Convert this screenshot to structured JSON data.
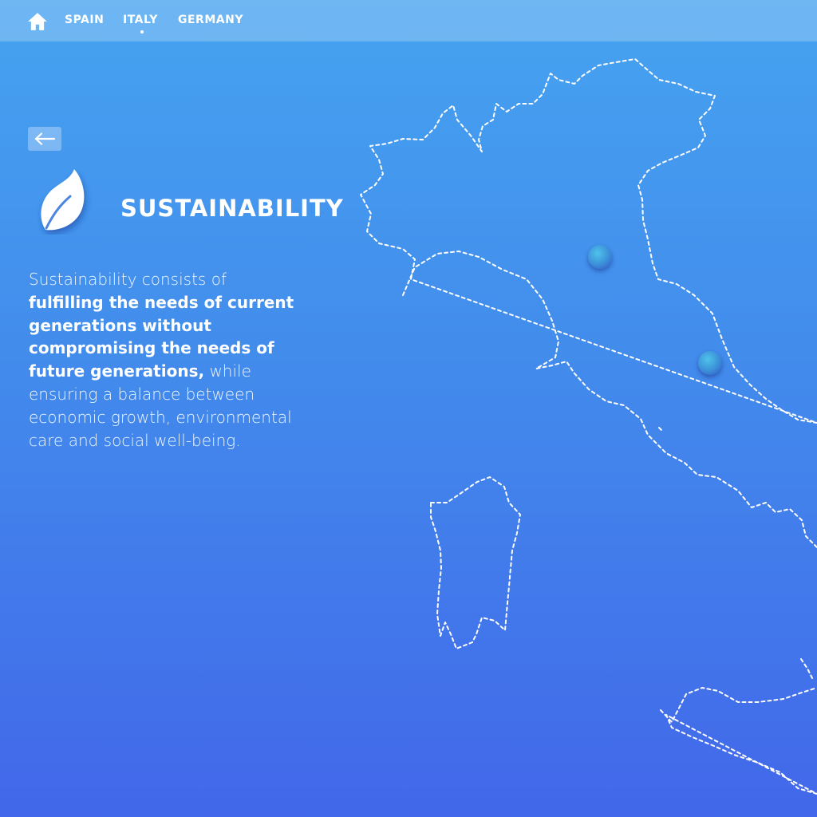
{
  "nav": {
    "home_icon": "home-icon",
    "links": [
      "SPAIN",
      "ITALY",
      "GERMANY"
    ],
    "active": "ITALY"
  },
  "back_icon": "arrow-left-icon",
  "section": {
    "icon": "leaf-icon",
    "title": "SUSTAINABILITY",
    "description": {
      "intro": "Sustainability consists of",
      "emphasis": "fulfilling the needs of current generations without compromising the needs of future generations,",
      "rest": "while ensuring a balance between economic growth, environmental care and social well-being."
    }
  },
  "map": {
    "region": "Italy",
    "marker_count": 2,
    "colors": {
      "outline": "#ffffff",
      "marker": "#3b8fd8"
    }
  },
  "colors": {
    "background_top": "#46a3f0",
    "background_bottom": "#4267ea",
    "text": "#ffffff"
  }
}
